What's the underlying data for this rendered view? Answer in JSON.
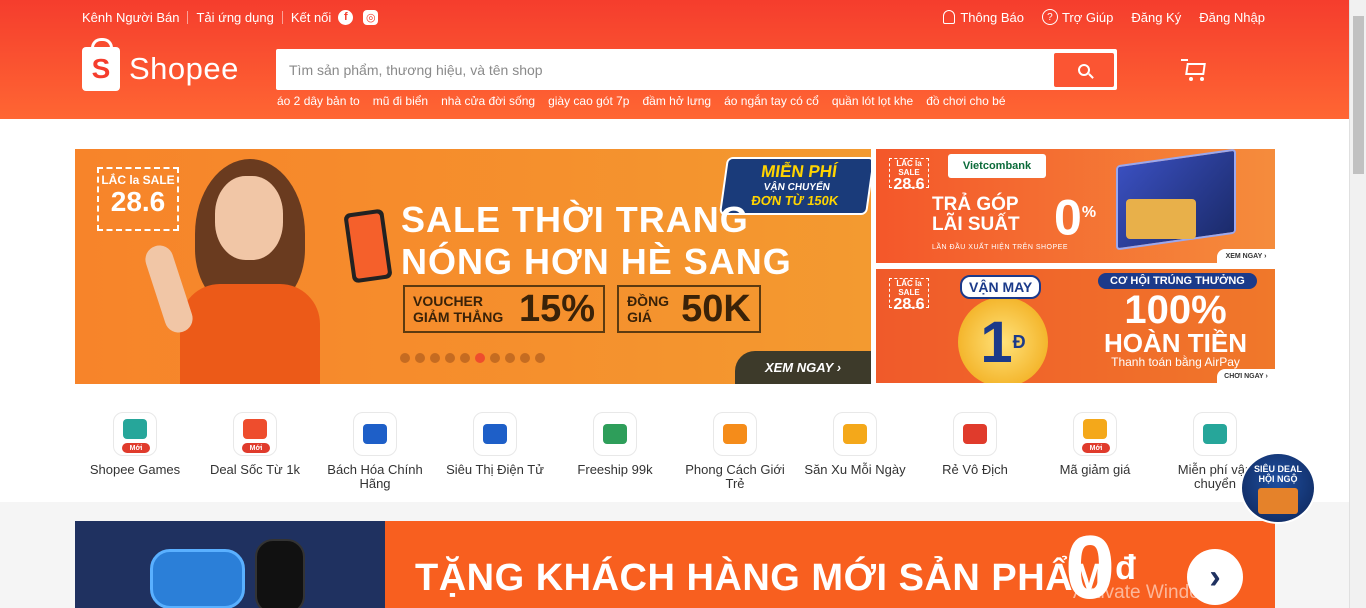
{
  "topbar": {
    "seller_channel": "Kênh Người Bán",
    "download_app": "Tải ứng dụng",
    "connect": "Kết nối",
    "notifications": "Thông Báo",
    "help": "Trợ Giúp",
    "register": "Đăng Ký",
    "login": "Đăng Nhập"
  },
  "logo": {
    "text": "Shopee",
    "mark": "S"
  },
  "search": {
    "placeholder": "Tìm sản phẩm, thương hiệu, và tên shop",
    "suggestions": [
      "áo 2 dây bản to",
      "mũ đi biển",
      "nhà cửa đời sống",
      "giày cao gót 7p",
      "đầm hở lưng",
      "áo ngắn tay có cổ",
      "quần lót lọt khe",
      "đồ chơi cho bé"
    ]
  },
  "banner_main": {
    "sale_tag_top": "LẮC la SALE",
    "sale_tag_date": "28.6",
    "free_ship_1": "MIỄN PHÍ",
    "free_ship_2": "VẬN CHUYỂN",
    "free_ship_3": "ĐƠN TỪ 150K",
    "headline_1": "SALE THỜI TRANG",
    "headline_2": "NÓNG HƠN HÈ SANG",
    "voucher_label": "VOUCHER GIẢM THẲNG",
    "voucher_value": "15%",
    "same_price_label": "ĐỒNG GIÁ",
    "same_price_value": "50K",
    "cta": "XEM NGAY ›",
    "slide_count": 10,
    "active_slide": 6
  },
  "banner_right_1": {
    "sale_tag_top": "LẮC la SALE",
    "sale_tag_date": "28.6",
    "bank": "Vietcombank",
    "line1": "TRẢ GÓP",
    "line2": "LÃI SUẤT",
    "rate": "0",
    "rate_unit": "%",
    "subline": "LẦN ĐẦU XUẤT HIỆN TRÊN SHOPEE",
    "cta": "XEM NGAY ›"
  },
  "banner_right_2": {
    "sale_tag_top": "LẮC la SALE",
    "sale_tag_date": "28.6",
    "lucky": "VẬN MAY",
    "coin_value": "1",
    "coin_unit": "Đ",
    "chance": "CƠ HỘI TRÚNG THƯỞNG",
    "percent": "100%",
    "refund": "HOÀN TIỀN",
    "payment": "Thanh toán bằng AirPay",
    "cta": "CHƠI NGAY ›"
  },
  "categories": [
    {
      "label": "Shopee Games",
      "icon": "gamepad-icon",
      "badge": "Mới",
      "color": "#26a69a"
    },
    {
      "label": "Deal Sốc Từ 1k",
      "icon": "ticket-fire-icon",
      "badge": "Mới",
      "color": "#ee4d2d"
    },
    {
      "label": "Bách Hóa Chính Hãng",
      "icon": "cart-icon",
      "badge": "",
      "color": "#1e5fc8"
    },
    {
      "label": "Siêu Thị Điện Tử",
      "icon": "devices-icon",
      "badge": "",
      "color": "#1e5fc8"
    },
    {
      "label": "Freeship 99k",
      "icon": "freeship-99k-icon",
      "badge": "",
      "color": "#2e9e5a"
    },
    {
      "label": "Phong Cách Giới Trẻ",
      "icon": "lightbulb-icon",
      "badge": "",
      "color": "#f58c1a"
    },
    {
      "label": "Săn Xu Mỗi Ngày",
      "icon": "coins-icon",
      "badge": "",
      "color": "#f4a81a"
    },
    {
      "label": "Rẻ Vô Địch",
      "icon": "cheap-badge-icon",
      "badge": "",
      "color": "#e03b2c"
    },
    {
      "label": "Mã giảm giá",
      "icon": "voucher-vnd-icon",
      "badge": "Mới",
      "color": "#f4a81a"
    },
    {
      "label": "Miễn phí vận chuyển",
      "icon": "freeship-ticket-icon",
      "badge": "",
      "color": "#26a69a"
    }
  ],
  "promo": {
    "text": "TẶNG KHÁCH HÀNG MỚI SẢN PHẨM",
    "price": "0",
    "price_unit": "đ"
  },
  "floating": {
    "line1": "SIÊU DEAL",
    "line2": "HỘI NGỘ"
  },
  "watermark": "Activate Windows",
  "colors": {
    "brand": "#ee4d2d",
    "header_bg": "#f63",
    "promo_bg": "#1f3160"
  }
}
